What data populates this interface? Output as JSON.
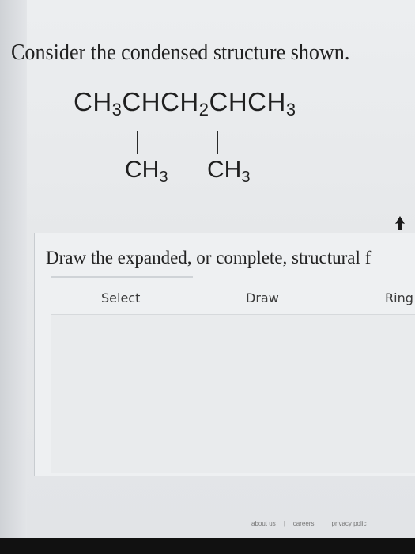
{
  "question": {
    "text": "Consider the condensed structure shown."
  },
  "structure": {
    "main_chain": [
      {
        "text": "CH",
        "sub": "3"
      },
      {
        "text": "CHCH",
        "sub": "2"
      },
      {
        "text": "CHCH",
        "sub": "3"
      }
    ],
    "branches": [
      {
        "text": "CH",
        "sub": "3"
      },
      {
        "text": "CH",
        "sub": "3"
      }
    ]
  },
  "panel": {
    "prompt": "Draw the expanded, or complete, structural f",
    "tools": {
      "select": "Select",
      "draw": "Draw",
      "rings": "Ring"
    }
  },
  "footer": {
    "about": "about us",
    "careers": "careers",
    "privacy": "privacy polic",
    "separator": "|"
  }
}
